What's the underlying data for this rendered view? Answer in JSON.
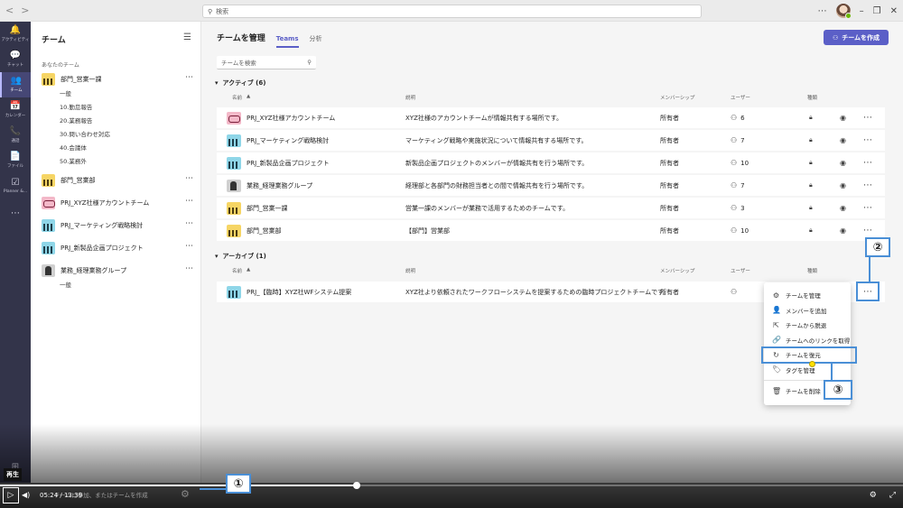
{
  "topbar": {
    "search_placeholder": "検索"
  },
  "rail": [
    {
      "icon": "bell-icon",
      "glyph": "🔔",
      "label": "アクティビティ"
    },
    {
      "icon": "chat-icon",
      "glyph": "💬",
      "label": "チャット"
    },
    {
      "icon": "teams-icon",
      "glyph": "👥",
      "label": "チーム",
      "active": true
    },
    {
      "icon": "calendar-icon",
      "glyph": "📅",
      "label": "カレンダー"
    },
    {
      "icon": "phone-icon",
      "glyph": "📞",
      "label": "通話"
    },
    {
      "icon": "file-icon",
      "glyph": "📄",
      "label": "ファイル"
    },
    {
      "icon": "planner-icon",
      "glyph": "☑",
      "label": "Planner &..."
    },
    {
      "icon": "more-icon",
      "glyph": "⋯",
      "label": ""
    }
  ],
  "leftpanel": {
    "title": "チーム",
    "section": "あなたのチーム",
    "teams": [
      {
        "name": "部門_営業一課",
        "color": "yellow",
        "channels": [
          "一般",
          "10.勤怠報告",
          "20.業務報告",
          "30.問い合わせ対応",
          "40.会議体",
          "50.業務外"
        ]
      },
      {
        "name": "部門_営業部",
        "color": "yellow",
        "channels": []
      },
      {
        "name": "PRJ_XYZ社様アカウントチーム",
        "color": "pink",
        "channels": []
      },
      {
        "name": "PRJ_マーケティング戦略検討",
        "color": "cyan",
        "channels": []
      },
      {
        "name": "PRJ_新製品企画プロジェクト",
        "color": "cyan",
        "channels": []
      },
      {
        "name": "業務_経理業務グループ",
        "color": "gray",
        "channels": [
          "一般"
        ]
      }
    ]
  },
  "main": {
    "title": "チームを管理",
    "tabs": [
      {
        "label": "Teams",
        "active": true
      },
      {
        "label": "分析",
        "active": false
      }
    ],
    "create_button": "チームを作成",
    "search_placeholder": "チームを検索",
    "columns": {
      "name": "名前",
      "description": "説明",
      "membership": "メンバーシップ",
      "users": "ユーザー",
      "type": "種類"
    },
    "active_group": "アクティブ (6)",
    "archive_group": "アーカイブ (1)",
    "active_rows": [
      {
        "name": "PRJ_XYZ社様アカウントチーム",
        "color": "pink",
        "description": "XYZ社様のアカウントチームが情報共有する場所です。",
        "membership": "所有者",
        "users": "6"
      },
      {
        "name": "PRJ_マーケティング戦略検討",
        "color": "cyan",
        "description": "マーケティング戦略や実施状況について情報共有する場所です。",
        "membership": "所有者",
        "users": "7"
      },
      {
        "name": "PRJ_新製品企画プロジェクト",
        "color": "cyan",
        "description": "新製品企画プロジェクトのメンバーが情報共有を行う場所です。",
        "membership": "所有者",
        "users": "10"
      },
      {
        "name": "業務_経理業務グループ",
        "color": "gray",
        "description": "経理部と各部門の財務担当者との間で情報共有を行う場所です。",
        "membership": "所有者",
        "users": "7"
      },
      {
        "name": "部門_営業一課",
        "color": "yellow",
        "description": "営業一課のメンバーが業務で活用するためのチームです。",
        "membership": "所有者",
        "users": "3"
      },
      {
        "name": "部門_営業部",
        "color": "yellow",
        "description": "【部門】営業部",
        "membership": "所有者",
        "users": "10"
      }
    ],
    "archive_rows": [
      {
        "name": "PRJ_【臨時】XYZ社WFシステム提案",
        "color": "cyan",
        "description": "XYZ社より依頼されたワークフローシステムを提案するための臨時プロジェクトチームです。",
        "membership": "所有者"
      }
    ]
  },
  "menu": [
    {
      "icon": "gear-icon",
      "glyph": "⚙",
      "label": "チームを管理"
    },
    {
      "icon": "add-member-icon",
      "glyph": "👤",
      "label": "メンバーを追加"
    },
    {
      "icon": "leave-icon",
      "glyph": "⇱",
      "label": "チームから脱退"
    },
    {
      "icon": "link-icon",
      "glyph": "🔗",
      "label": "チームへのリンクを取得"
    },
    {
      "icon": "restore-icon",
      "glyph": "↻",
      "label": "チームを復元"
    },
    {
      "icon": "tag-icon",
      "glyph": "🏷",
      "label": "タグを管理"
    },
    {
      "icon": "delete-icon",
      "glyph": "🗑",
      "label": "チームを削除"
    }
  ],
  "callouts": {
    "one": "①",
    "two": "②",
    "three": "③"
  },
  "player": {
    "time": "05:24 / 13:39",
    "label": "再生",
    "ghost": "チームに参加、またはチームを作成",
    "progress": 0.395
  }
}
